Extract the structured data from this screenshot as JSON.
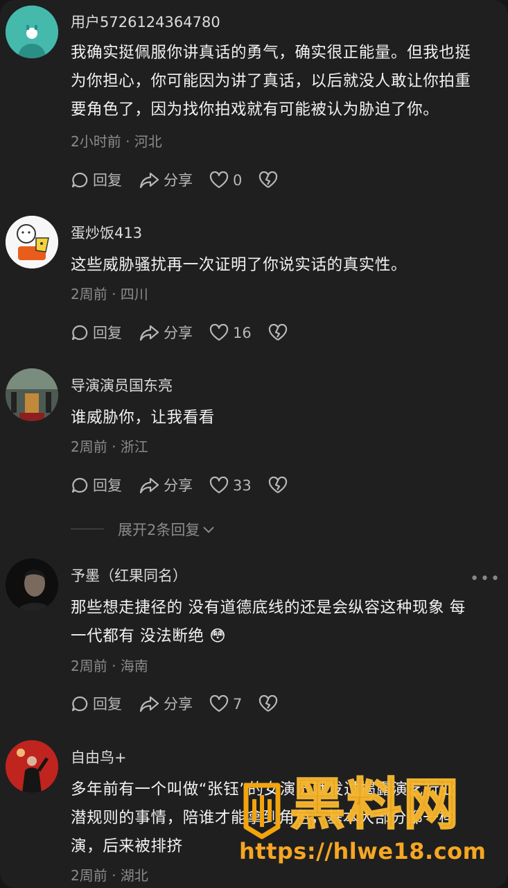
{
  "actions": {
    "reply_label": "回复",
    "share_label": "分享"
  },
  "comments": [
    {
      "username": "用户5726124364780",
      "lines": [
        "我确实挺佩服你讲真话的勇气，确实很正能量。但我也挺",
        "为你担心，你可能因为讲了真话，以后就没人敢让你拍重",
        "要角色了，因为找你拍戏就有可能被认为胁迫了你。"
      ],
      "meta": "2小时前 · 河北",
      "likes": "0"
    },
    {
      "username": "蛋炒饭413",
      "lines": [
        "这些威胁骚扰再一次证明了你说实话的真实性。"
      ],
      "meta": "2周前 · 四川",
      "likes": "16"
    },
    {
      "username": "导演演员国东亮",
      "lines": [
        "谁威胁你，让我看看"
      ],
      "meta": "2周前 · 浙江",
      "likes": "33",
      "expand_label": "展开2条回复"
    },
    {
      "username": "予墨（红果同名）",
      "lines": [
        "那些想走捷径的 没有道德底线的还是会纵容这种现象 每",
        "一代都有 没法断绝 😳"
      ],
      "meta": "2周前 · 海南",
      "likes": "7"
    },
    {
      "username": "自由鸟+",
      "lines": [
        "多年前有一个叫做“张钰”的女演员就发过揭露演艺行业",
        "潜规则的事情，陪谁才能拿到角色，基本大部分都一样",
        "演，后来被排挤"
      ],
      "meta": "2周前 · 湖北"
    }
  ],
  "watermark": {
    "title": "黑料网",
    "url": "https://hlwe18.com"
  },
  "colors": {
    "background": "#1f1f1f",
    "text": "#f2f2f2",
    "meta": "#8b8b8b",
    "watermark": "#f2a40e"
  }
}
